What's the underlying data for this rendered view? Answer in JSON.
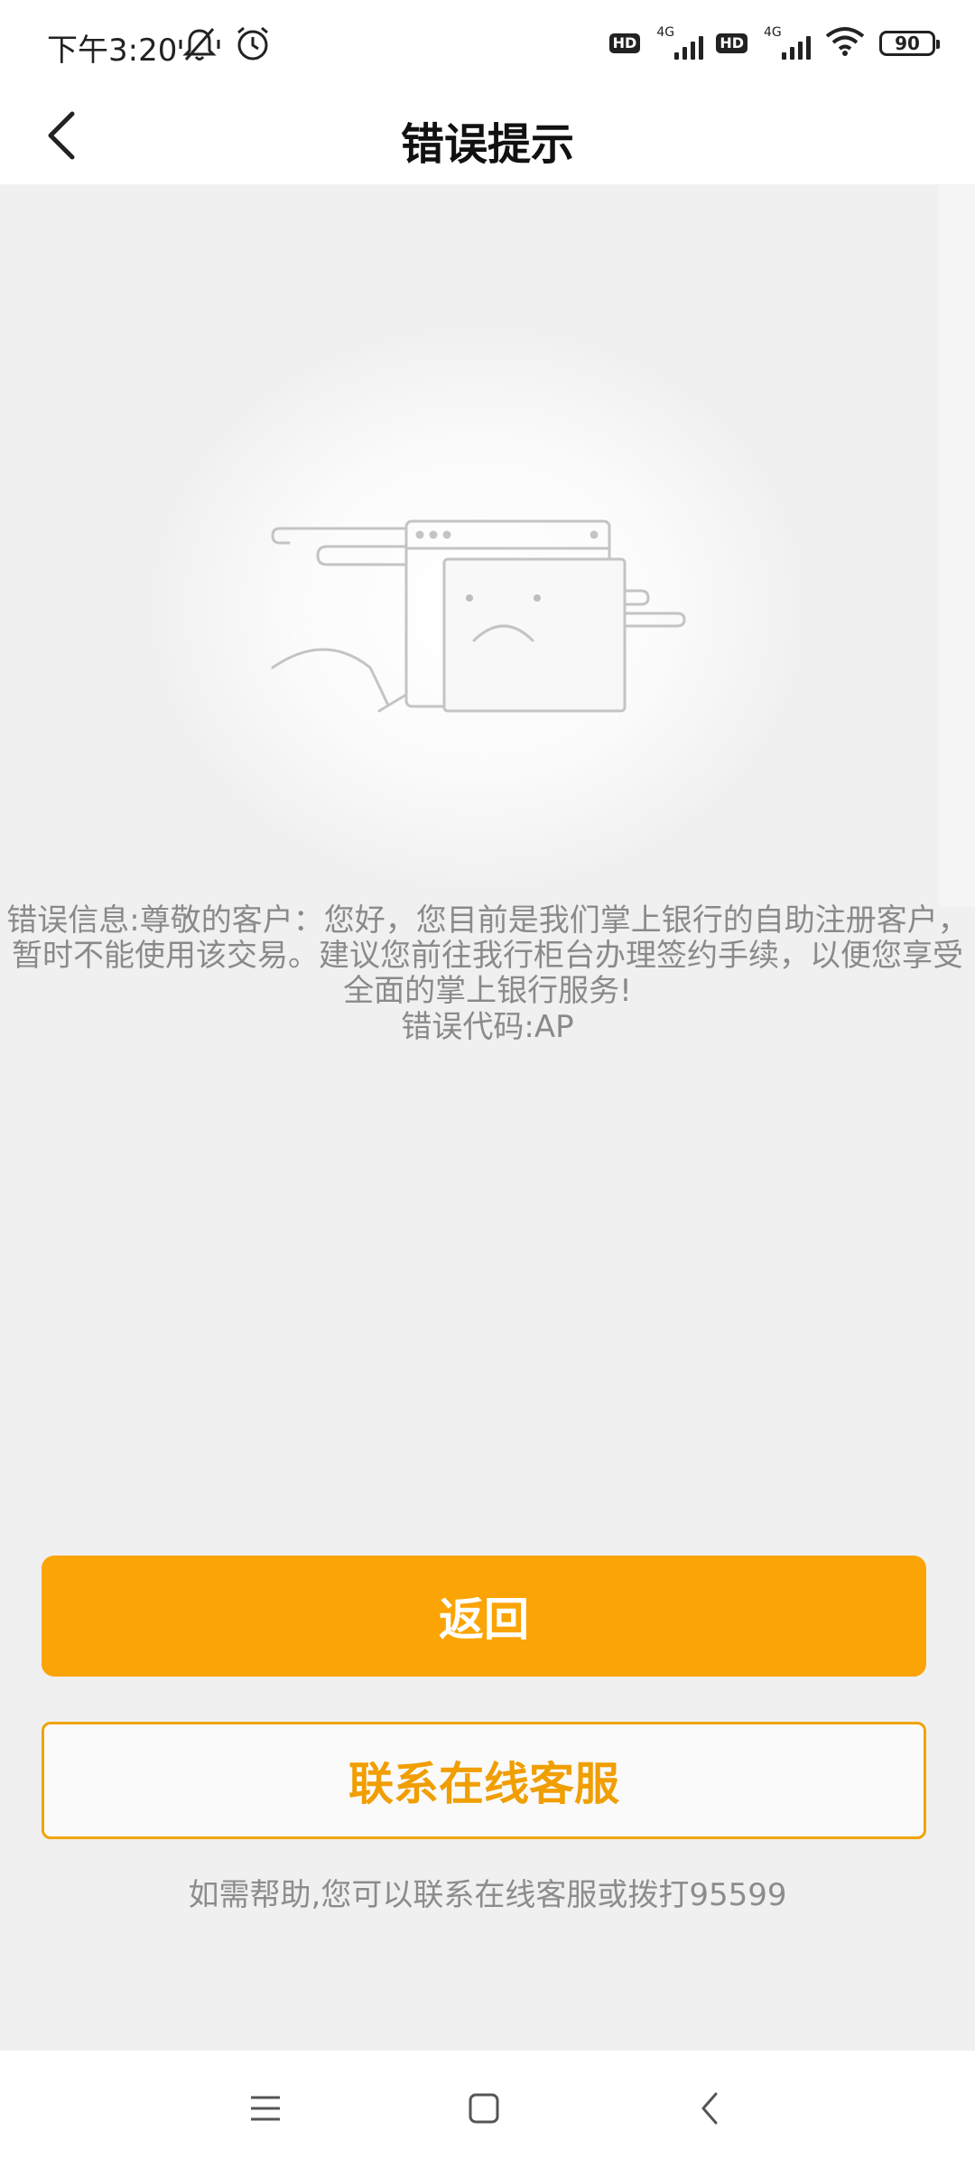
{
  "status_bar": {
    "time": "下午3:20",
    "hd_label": "HD",
    "network_label": "4G",
    "battery": "90"
  },
  "header": {
    "title": "错误提示"
  },
  "error": {
    "message_line1": "错误信息:尊敬的客户：您好，您目前是我们掌上银行的自助注册客户，",
    "message_line2": "暂时不能使用该交易。建议您前往我行柜台办理签约手续，以便您享受",
    "message_line3": "全面的掌上银行服务!",
    "code": "错误代码:AP"
  },
  "actions": {
    "return_label": "返回",
    "contact_label": "联系在线客服"
  },
  "help_text": "如需帮助,您可以联系在线客服或拨打95599",
  "colors": {
    "accent": "#faa406",
    "text_muted": "#8a8a8a"
  },
  "icons": {
    "back": "chevron-left-icon",
    "menu": "menu-icon",
    "home": "home-icon",
    "nav_back": "back-icon"
  }
}
